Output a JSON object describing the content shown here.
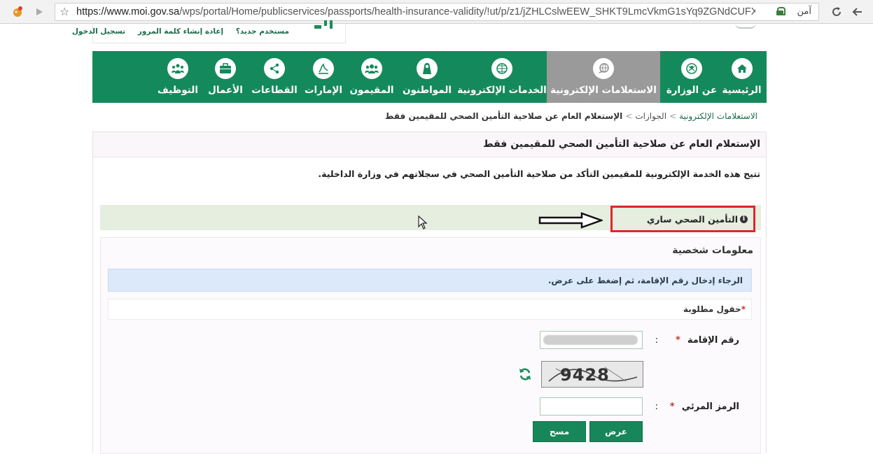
{
  "browser": {
    "url_host": "https://www.moi.gov.sa",
    "url_path": "/wps/portal/Home/publicservices/passports/health-insurance-validity/!ut/p/z1/jZHLCslwEEW_SHKT9LmcVkmG1sYq9ZGNdCUFX4j4_ZYK7...",
    "secure_label": "آمن",
    "icons": [
      "extension-icon",
      "reload-icon",
      "forward-icon",
      "star-icon",
      "lock-icon"
    ]
  },
  "top_links": {
    "new_user": "مستخدم جديد؟",
    "reset_password": "إعادة إنشاء كلمة المرور",
    "login": "تسجيل الدخول"
  },
  "nav": {
    "items": [
      {
        "label": "الرئيسية",
        "icon": "home-icon",
        "active": false
      },
      {
        "label": "عن الوزارة",
        "icon": "emblem-icon",
        "active": false
      },
      {
        "label": "الاستعلامات الإلكترونية",
        "icon": "globe-hand-icon",
        "active": true
      },
      {
        "label": "الخدمات الإلكترونية",
        "icon": "globe-icon",
        "active": false
      },
      {
        "label": "المواطنون",
        "icon": "citizen-icon",
        "active": false
      },
      {
        "label": "المقيمون",
        "icon": "residents-icon",
        "active": false
      },
      {
        "label": "الإمارات",
        "icon": "emirates-icon",
        "active": false
      },
      {
        "label": "القطاعات",
        "icon": "sectors-icon",
        "active": false
      },
      {
        "label": "الأعمال",
        "icon": "briefcase-icon",
        "active": false
      },
      {
        "label": "التوظيف",
        "icon": "employment-icon",
        "active": false
      }
    ]
  },
  "breadcrumb": {
    "level1": "الاستعلامات الإلكترونية",
    "level2": "الجوازات",
    "level3": "الإستعلام العام عن صلاحية التأمين الصحي للمقيمين فقط",
    "separator": ">"
  },
  "main": {
    "title": "الإستعلام العام عن صلاحية التأمين الصحي للمقيمين فقط",
    "description": "تتيح هذه الخدمة الإلكترونية للمقيمين التأكد من صلاحية التأمين الصحي في سجلاتهم في وزارة الداخلية.",
    "status_text": "التأمين الصحي ساري",
    "status_icon": "info-icon",
    "highlight_color": "#e0262b"
  },
  "form": {
    "section_title": "معلومات شخصية",
    "instruction": "الرجاء إدخال رقم الإقامة، ثم إضغط على عرض.",
    "required_note": "حقول مطلوبة",
    "required_mark": "*",
    "iqama_label": "رقم الإقامة",
    "iqama_value": "",
    "captcha_text": "9428",
    "captcha_label": "الرمز المرئي",
    "captcha_value": "",
    "colon": ":",
    "submit_label": "عرض",
    "clear_label": "مسح"
  },
  "colors": {
    "brand_green": "#148a5c",
    "active_nav": "#9a9a9a"
  }
}
